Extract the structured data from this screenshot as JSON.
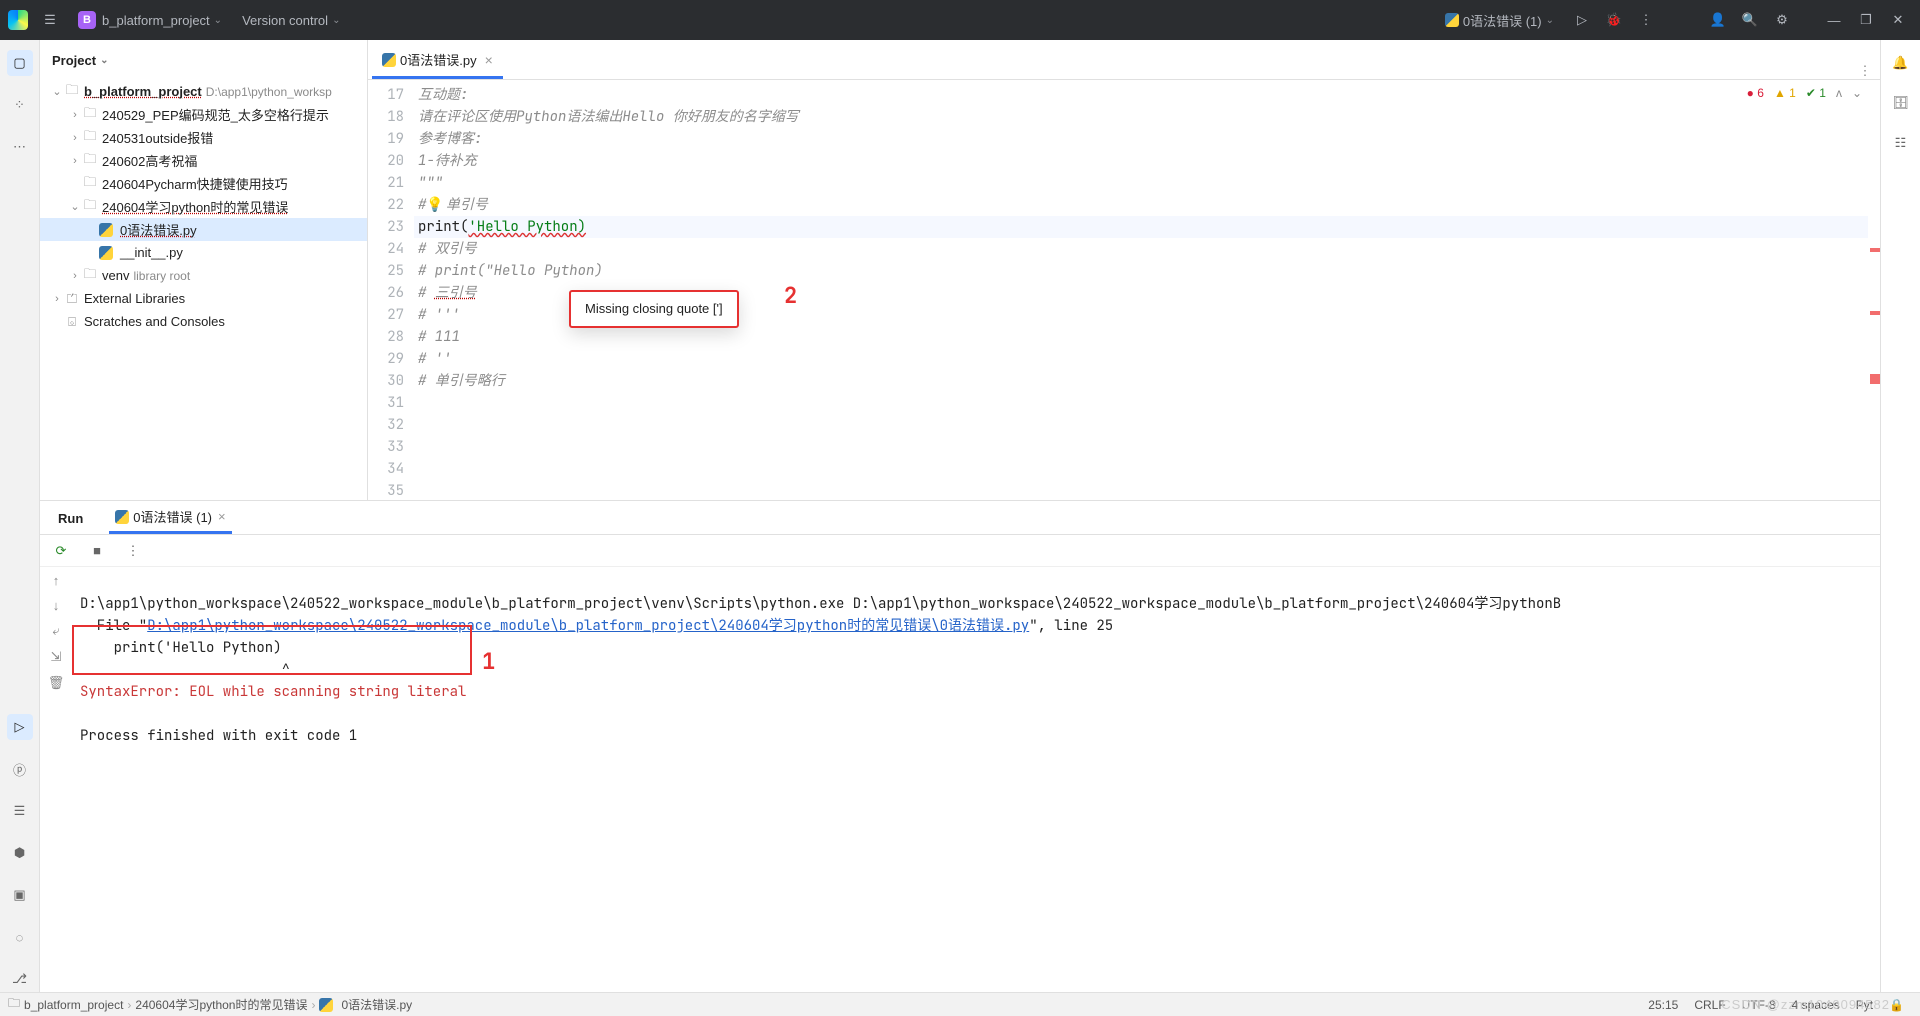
{
  "titlebar": {
    "project_initial": "B",
    "project_name": "b_platform_project",
    "vcs_label": "Version control",
    "run_config": "0语法错误 (1)"
  },
  "project_panel": {
    "title": "Project"
  },
  "tree": {
    "root": "b_platform_project",
    "root_path": "D:\\app1\\python_worksp",
    "n0": "240529_PEP编码规范_太多空格行提示",
    "n1": "240531outside报错",
    "n2": "240602高考祝福",
    "n3": "240604Pycharm快捷键使用技巧",
    "n4": "240604学习python时的常见错误",
    "f0": "0语法错误.py",
    "f1": "__init__.py",
    "venv": "venv",
    "venv_hint": "library root",
    "ext_lib": "External Libraries",
    "scratch": "Scratches and Consoles"
  },
  "tab": {
    "name": "0语法错误.py"
  },
  "badges": {
    "err": "6",
    "warn": "1",
    "ok": "1"
  },
  "code": {
    "l17": "互动题:",
    "l18": "请在评论区使用Python语法编出Hello 你好朋友的名字缩写",
    "l19": "",
    "l20": "参考博客:",
    "l21": "1-待补充",
    "l22": "\"\"\"",
    "l23": "",
    "l24a": "#",
    "l24b": "单引号",
    "l25a": "print",
    "l25b": "(",
    "l25c": "'Hello Python)",
    "l26": "",
    "l27": "# 双引号",
    "l28": "# print(\"Hello Python)",
    "l29": "",
    "l30a": "# ",
    "l30b": "三引号",
    "l31": "# '''",
    "l32": "# 111",
    "l33": "# ''",
    "l34": "",
    "l35": "# 单引号略行"
  },
  "gutter": [
    "17",
    "18",
    "19",
    "20",
    "21",
    "22",
    "23",
    "24",
    "25",
    "26",
    "27",
    "28",
    "29",
    "30",
    "31",
    "32",
    "33",
    "34",
    "35"
  ],
  "tooltip": {
    "text": "Missing closing quote [']",
    "annot": "2"
  },
  "run": {
    "title": "Run",
    "tab": "0语法错误 (1)",
    "cmd": "D:\\app1\\python_workspace\\240522_workspace_module\\b_platform_project\\venv\\Scripts\\python.exe D:\\app1\\python_workspace\\240522_workspace_module\\b_platform_project\\240604学习pythonB",
    "file_pre": "  File \"",
    "file_link": "D:\\app1\\python_workspace\\240522_workspace_module\\b_platform_project\\240604学习python时的常见错误\\0语法错误.py",
    "file_post": "\", line 25",
    "ctx": "    print('Hello Python)",
    "caret": "                        ^",
    "err": "SyntaxError: EOL while scanning string literal",
    "exit": "Process finished with exit code 1",
    "annot": "1"
  },
  "status": {
    "c0": "b_platform_project",
    "c1": "240604学习python时的常见错误",
    "c2": "0语法错误.py",
    "pos": "25:15",
    "eol": "CRLF",
    "enc": "UTF-8",
    "indent": "4 spaces",
    "interp": "Pyt",
    "lock": "🔒"
  },
  "watermark": "CSDN @zzm1040094582"
}
